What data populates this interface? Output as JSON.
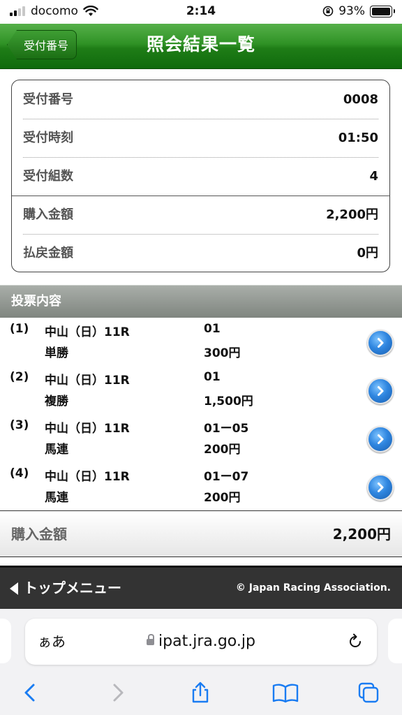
{
  "status_bar": {
    "carrier": "docomo",
    "time": "2:14",
    "battery": "93%"
  },
  "header": {
    "back_label": "受付番号",
    "title": "照会結果一覧"
  },
  "summary": {
    "rows": [
      {
        "label": "受付番号",
        "value": "0008"
      },
      {
        "label": "受付時刻",
        "value": "01:50"
      },
      {
        "label": "受付組数",
        "value": "4"
      },
      {
        "label": "購入金額",
        "value": "2,200円"
      },
      {
        "label": "払戻金額",
        "value": "0円"
      }
    ]
  },
  "section": {
    "title": "投票内容"
  },
  "bets": [
    {
      "number": "(1)",
      "race": "中山（日）11R",
      "type": "単勝",
      "combo": "01",
      "amount": "300円"
    },
    {
      "number": "(2)",
      "race": "中山（日）11R",
      "type": "複勝",
      "combo": "01",
      "amount": "1,500円"
    },
    {
      "number": "(3)",
      "race": "中山（日）11R",
      "type": "馬連",
      "combo": "01ー05",
      "amount": "200円"
    },
    {
      "number": "(4)",
      "race": "中山（日）11R",
      "type": "馬連",
      "combo": "01ー07",
      "amount": "200円"
    }
  ],
  "total": {
    "label": "購入金額",
    "value": "2,200円"
  },
  "footer": {
    "top_menu": "トップメニュー",
    "copyright": "© Japan Racing Association."
  },
  "browser": {
    "aa": "ぁあ",
    "url": "ipat.jra.go.jp"
  },
  "colors": {
    "header_green": "#2f9225",
    "section_gray": "#8f948f",
    "footer_dark": "#333333",
    "link_blue": "#2f86e0"
  }
}
